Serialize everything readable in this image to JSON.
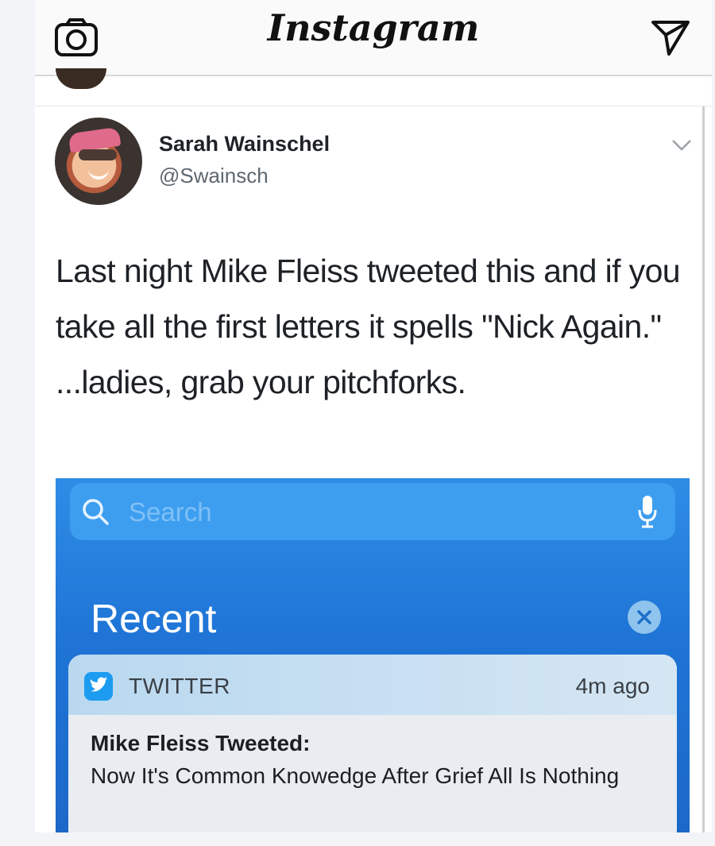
{
  "app": {
    "title": "Instagram"
  },
  "post": {
    "user_name": "Sarah Wainschel",
    "user_handle": "@Swainsch",
    "text": "Last night Mike Fleiss tweeted this and if you take all the first letters it spells \"Nick Again.\" ...ladies, grab your pitchforks."
  },
  "screenshot": {
    "search_placeholder": "Search",
    "section_title": "Recent",
    "notification": {
      "app_name": "TWITTER",
      "time": "4m ago",
      "title": "Mike Fleiss Tweeted:",
      "body": "Now It's Common Knowedge After Grief All Is Nothing"
    }
  },
  "colors": {
    "ios_blue": "#1f74d6",
    "twitter_blue": "#1d9bf0"
  },
  "icons": [
    "camera-icon",
    "send-icon",
    "chevron-down-icon",
    "search-icon",
    "mic-icon",
    "clear-icon",
    "twitter-icon"
  ]
}
